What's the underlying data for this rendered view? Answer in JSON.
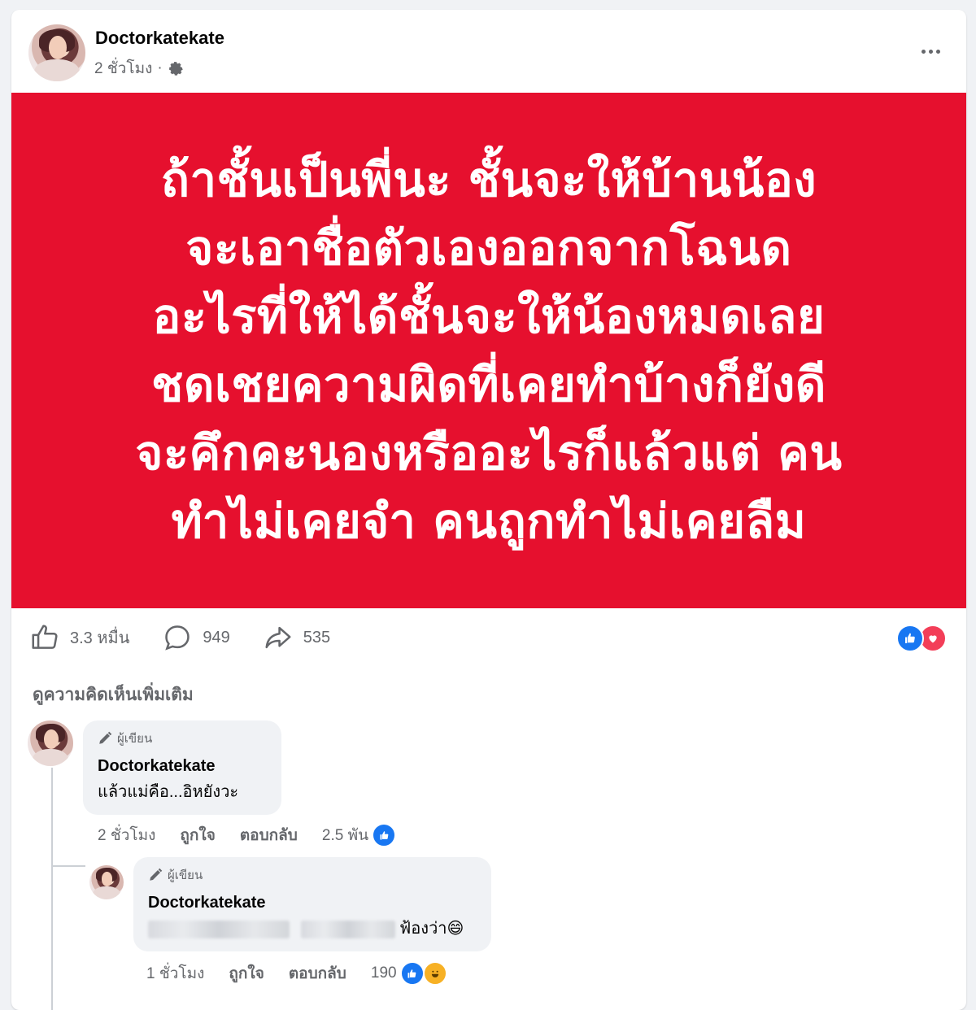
{
  "post": {
    "author": "Doctorkatekate",
    "time": "2 ชั่วโมง",
    "separator": "·",
    "privacy_icon": "gear-icon",
    "banner_color": "#e6102e",
    "banner_lines": [
      "ถ้าชั้นเป็นพี่นะ ชั้นจะให้บ้านน้อง",
      "จะเอาชื่อตัวเองออกจากโฉนด",
      "อะไรที่ให้ได้ชั้นจะให้น้องหมดเลย",
      "ชดเชยความผิดที่เคยทำบ้างก็ยังดี",
      "จะคึกคะนองหรืออะไรก็แล้วแต่ คน",
      "ทำไม่เคยจำ คนถูกทำไม่เคยลืม"
    ]
  },
  "actions": {
    "like_count": "3.3 หมื่น",
    "comment_count": "949",
    "share_count": "535"
  },
  "reactions": [
    "like-icon",
    "love-icon"
  ],
  "view_more_comments": "ดูความคิดเห็นเพิ่มเติม",
  "comments": [
    {
      "badge": "ผู้เขียน",
      "name": "Doctorkatekate",
      "text": "แล้วแม่คือ...อิหยังวะ",
      "time": "2 ชั่วโมง",
      "like_label": "ถูกใจ",
      "reply_label": "ตอบกลับ",
      "reaction_count": "2.5 พัน"
    },
    {
      "badge": "ผู้เขียน",
      "name": "Doctorkatekate",
      "text_suffix": "ฟ้องว่า",
      "emoji": "😄",
      "time": "1 ชั่วโมง",
      "like_label": "ถูกใจ",
      "reply_label": "ตอบกลับ",
      "reaction_count": "190"
    }
  ],
  "colors": {
    "like_blue": "#1877f2",
    "love_red": "#f33e58",
    "haha_yellow": "#f7b125",
    "secondary_text": "#65676b"
  }
}
